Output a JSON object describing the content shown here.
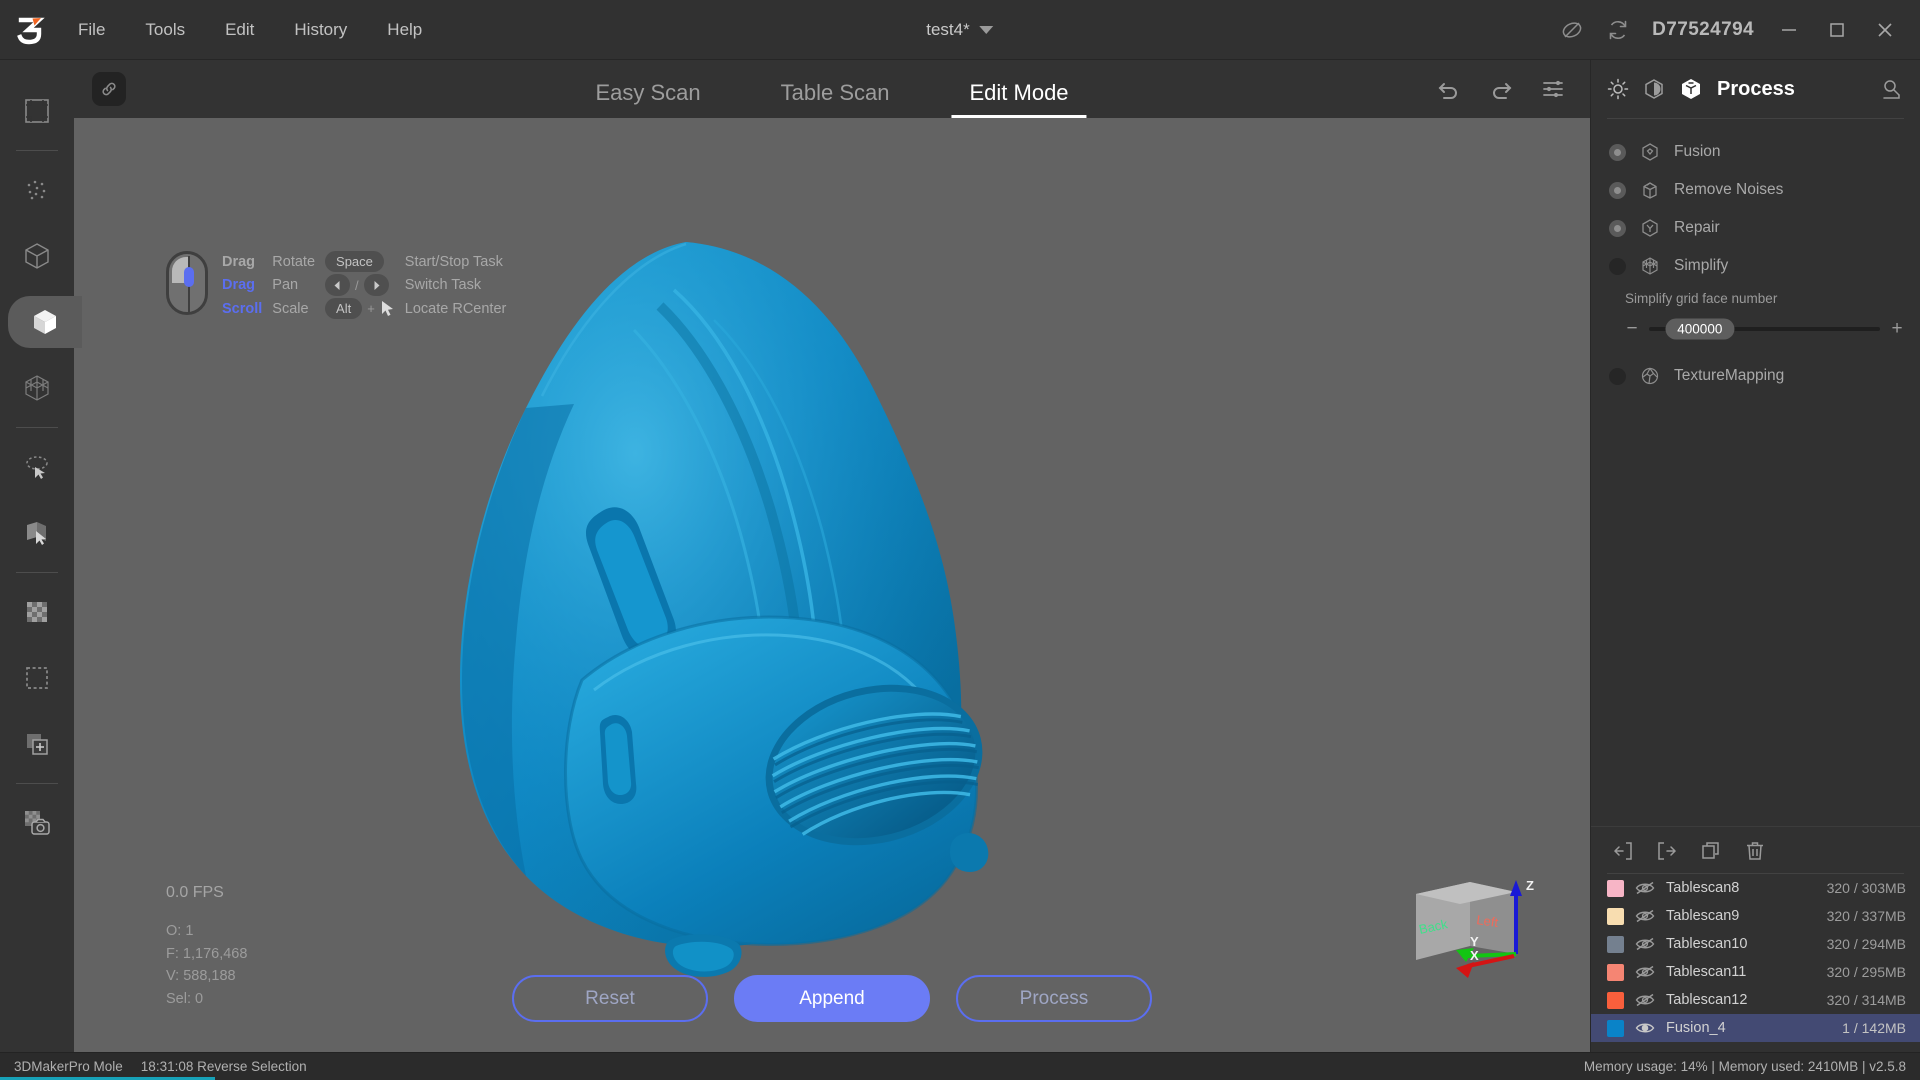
{
  "titlebar": {
    "logo_icon": "brand-3-logo",
    "menus": [
      {
        "label": "File"
      },
      {
        "label": "Tools"
      },
      {
        "label": "Edit"
      },
      {
        "label": "History"
      },
      {
        "label": "Help"
      }
    ],
    "project_name": "test4*",
    "project_caret_icon": "chevron-down-icon",
    "globe_icon": "network-disabled-icon",
    "sync_icon": "sync-refresh-icon",
    "device_id": "D77524794",
    "minimize_icon": "minimize-icon",
    "maximize_icon": "maximize-icon",
    "close_icon": "close-icon"
  },
  "left_toolbar": {
    "items": [
      {
        "icon": "frame-crop-icon",
        "active": false
      },
      {
        "icon": "point-cloud-icon",
        "active": false
      },
      {
        "icon": "wireframe-cube-icon",
        "active": false
      },
      {
        "icon": "solid-cube-icon",
        "active": true
      },
      {
        "icon": "mesh-cube-icon",
        "active": false
      },
      {
        "icon": "lasso-select-icon",
        "active": false
      },
      {
        "icon": "plane-select-icon",
        "active": false
      },
      {
        "icon": "checkerboard-icon",
        "active": false
      },
      {
        "icon": "marquee-select-icon",
        "active": false
      },
      {
        "icon": "add-layer-icon",
        "active": false
      },
      {
        "icon": "camera-snapshot-icon",
        "active": false
      }
    ]
  },
  "tabbar": {
    "link_icon": "link-chain-icon",
    "tabs": [
      {
        "label": "Easy Scan",
        "active": false
      },
      {
        "label": "Table Scan",
        "active": false
      },
      {
        "label": "Edit Mode",
        "active": true
      }
    ],
    "undo_icon": "undo-icon",
    "redo_icon": "redo-icon",
    "settings_icon": "sliders-settings-icon"
  },
  "viewport": {
    "help": {
      "mouse_icon": "mouse-icon",
      "rows": [
        {
          "key": "Drag",
          "key_style": "gray",
          "action": "Rotate"
        },
        {
          "key": "Drag",
          "key_style": "blue",
          "action": "Pan"
        },
        {
          "key": "Scroll",
          "key_style": "blue",
          "action": "Scale"
        }
      ],
      "shortcuts": [
        {
          "keycap": "Space",
          "label": "Start/Stop Task",
          "type": "cap"
        },
        {
          "keycap": "",
          "label": "Switch Task",
          "type": "arrows",
          "sep": "/"
        },
        {
          "keycap": "Alt",
          "label": "Locate RCenter",
          "type": "alt-cursor",
          "plus": "+"
        }
      ]
    },
    "stats": {
      "fps": "0.0 FPS",
      "objects": "O: 1",
      "faces": "F: 1,176,468",
      "vertices": "V: 588,188",
      "selected": "Sel: 0"
    },
    "actions": [
      {
        "label": "Reset",
        "style": "outline"
      },
      {
        "label": "Append",
        "style": "filled"
      },
      {
        "label": "Process",
        "style": "outline"
      }
    ],
    "gizmo": {
      "face_back": "Back",
      "face_left": "Left",
      "axis_x": "X",
      "axis_y": "Y",
      "axis_z": "Z",
      "color_x": "#d41414",
      "color_y": "#13c413",
      "color_z": "#1a1ad6"
    },
    "model_color": "#0d87c4",
    "background_color": "#636363"
  },
  "right_panel": {
    "brightness_icon": "sun-brightness-icon",
    "contrast_icon": "contrast-icon",
    "cube_icon": "process-cube-icon",
    "title": "Process",
    "expand_icon": "collapse-panel-icon",
    "process_items": [
      {
        "label": "Fusion",
        "icon": "fusion-cube-icon",
        "checked": true
      },
      {
        "label": "Remove Noises",
        "icon": "remove-noise-cube-icon",
        "checked": true
      },
      {
        "label": "Repair",
        "icon": "repair-cube-icon",
        "checked": true
      },
      {
        "label": "Simplify",
        "icon": "simplify-cube-icon",
        "checked": false
      }
    ],
    "slider": {
      "caption": "Simplify grid face number",
      "minus": "−",
      "plus": "+",
      "value": "400000"
    },
    "texture_item": {
      "label": "TextureMapping",
      "icon": "texture-mapping-icon",
      "checked": false
    },
    "list_toolbar": [
      {
        "icon": "import-icon"
      },
      {
        "icon": "export-icon"
      },
      {
        "icon": "duplicate-icon"
      },
      {
        "icon": "delete-trash-icon"
      }
    ],
    "scans": [
      {
        "color": "#f7b5c6",
        "visible": false,
        "name": "Tablescan8",
        "stats": "320 / 303MB",
        "selected": false
      },
      {
        "color": "#f8ddb0",
        "visible": false,
        "name": "Tablescan9",
        "stats": "320 / 337MB",
        "selected": false
      },
      {
        "color": "#74808f",
        "visible": false,
        "name": "Tablescan10",
        "stats": "320 / 294MB",
        "selected": false
      },
      {
        "color": "#f58573",
        "visible": false,
        "name": "Tablescan11",
        "stats": "320 / 295MB",
        "selected": false
      },
      {
        "color": "#f95f3c",
        "visible": false,
        "name": "Tablescan12",
        "stats": "320 / 314MB",
        "selected": false
      },
      {
        "color": "#0a83c8",
        "visible": true,
        "name": "Fusion_4",
        "stats": "1 / 142MB",
        "selected": true
      }
    ]
  },
  "statusbar": {
    "device": "3DMakerPro Mole",
    "log": "18:31:08 Reverse Selection",
    "memory": "Memory usage: 14% | Memory used: 2410MB | v2.5.8"
  }
}
